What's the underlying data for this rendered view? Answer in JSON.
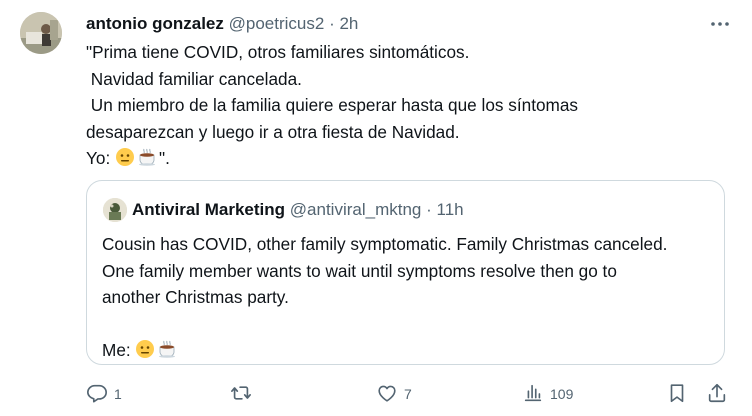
{
  "tweet": {
    "author_name": "antonio gonzalez",
    "author_handle": "@poetricus2",
    "separator": "·",
    "time": "2h",
    "lines": [
      "\"Prima tiene COVID, otros familiares sintomáticos.",
      " Navidad familiar cancelada.",
      " Un miembro de la familia quiere esperar hasta que los síntomas",
      "desaparezcan y luego ir a otra fiesta de Navidad."
    ],
    "last_line_prefix": "Yo: ",
    "last_line_suffix": "\"."
  },
  "quote": {
    "author_name": "Antiviral Marketing",
    "author_handle": "@antiviral_mktng",
    "separator": "·",
    "time": "11h",
    "lines": [
      "Cousin has COVID, other family symptomatic. Family Christmas canceled.",
      "One family member wants to wait until symptoms resolve then go to",
      "another Christmas party."
    ],
    "last_line_prefix": "Me: "
  },
  "actions": {
    "reply_count": "1",
    "retweet_count": "",
    "like_count": "7",
    "views_count": "109"
  },
  "colors": {
    "text": "#0f1419",
    "secondary": "#536471",
    "border": "#cfd9de"
  },
  "icons": {
    "emoji_1": "neutral-face",
    "emoji_2": "hot-beverage",
    "reply": "reply-icon",
    "retweet": "retweet-icon",
    "like": "heart-icon",
    "views": "views-icon",
    "bookmark": "bookmark-icon",
    "share": "share-icon",
    "more": "more-icon"
  }
}
